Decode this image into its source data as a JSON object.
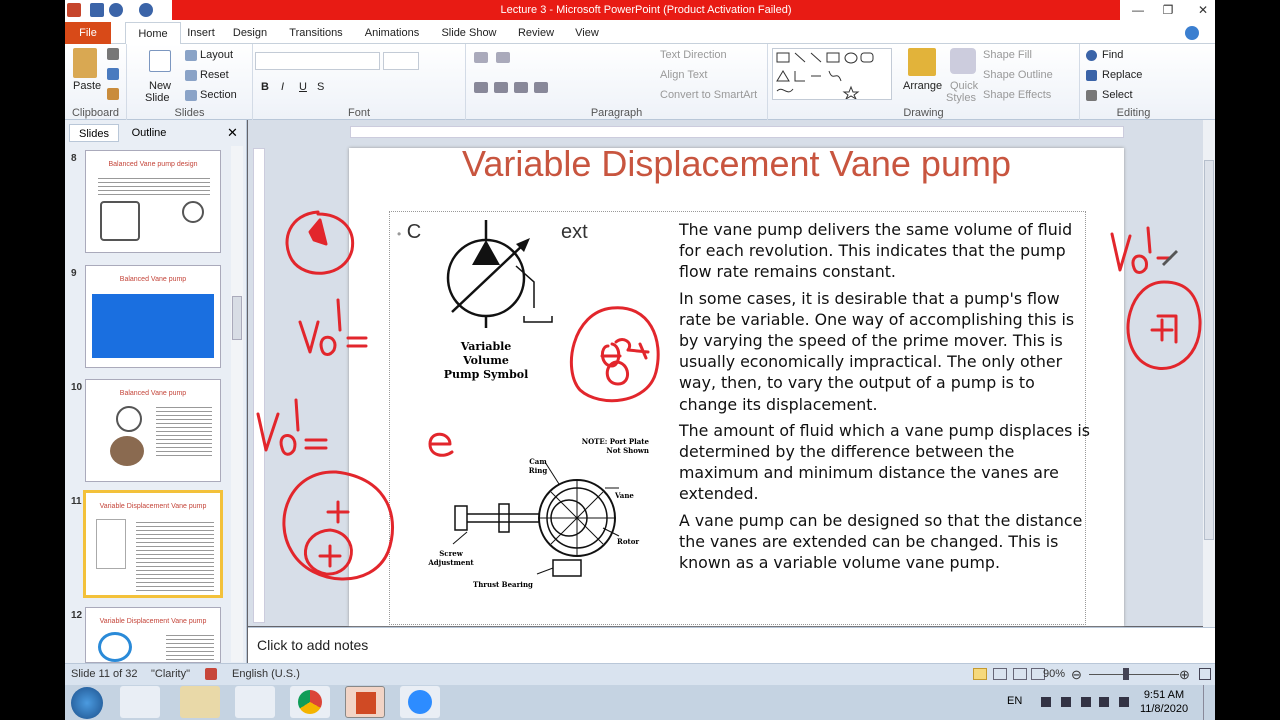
{
  "window": {
    "title": "Lecture 3  -  Microsoft PowerPoint (Product Activation Failed)"
  },
  "tabs": {
    "file": "File",
    "home": "Home",
    "insert": "Insert",
    "design": "Design",
    "transitions": "Transitions",
    "animations": "Animations",
    "slideshow": "Slide Show",
    "review": "Review",
    "view": "View"
  },
  "ribbon": {
    "clipboard": {
      "label": "Clipboard",
      "paste": "Paste"
    },
    "slides": {
      "label": "Slides",
      "new_slide_1": "New",
      "new_slide_2": "Slide",
      "layout": "Layout",
      "reset": "Reset",
      "section": "Section"
    },
    "font": {
      "label": "Font"
    },
    "paragraph": {
      "label": "Paragraph",
      "text_direction": "Text Direction",
      "align_text": "Align Text",
      "convert_smartart": "Convert to SmartArt"
    },
    "drawing": {
      "label": "Drawing",
      "arrange": "Arrange",
      "quick_styles_1": "Quick",
      "quick_styles_2": "Styles",
      "shape_fill": "Shape Fill",
      "shape_outline": "Shape Outline",
      "shape_effects": "Shape Effects"
    },
    "editing": {
      "label": "Editing",
      "find": "Find",
      "replace": "Replace",
      "select": "Select"
    }
  },
  "left_pane": {
    "tab_slides": "Slides",
    "tab_outline": "Outline",
    "thumbnails": [
      {
        "num": "8",
        "title": "Balanced Vane pump design"
      },
      {
        "num": "9",
        "title": "Balanced Vane pump"
      },
      {
        "num": "10",
        "title": "Balanced Vane pump"
      },
      {
        "num": "11",
        "title": "Variable Displacement Vane pump"
      },
      {
        "num": "12",
        "title": "Variable Displacement Vane pump"
      }
    ]
  },
  "slide": {
    "title": "Variable Displacement Vane pump",
    "bullet_fragment_a": "C",
    "bullet_fragment_b": "ext",
    "symbol_caption_1": "Variable Volume",
    "symbol_caption_2": "Pump Symbol",
    "diagram_labels": {
      "note": "NOTE: Port Plate",
      "not_shown": "Not Shown",
      "cam": "Cam",
      "ring": "Ring",
      "vane": "Vane",
      "rotor": "Rotor",
      "screw": "Screw",
      "adjustment": "Adjustment",
      "thrust": "Thrust Bearing"
    },
    "paragraphs": [
      "The vane pump delivers the same volume of fluid for each revolution. This indicates that the pump flow rate remains constant.",
      "In some cases, it is desirable that a pump's flow rate be variable. One way of accomplishing this is by varying the speed of the prime mover. This is usually economically impractical. The only other way, then, to vary the output of a pump is to change its displacement.",
      "The amount of fluid which a vane pump displaces is determined by the difference between the maximum and minimum distance the vanes are extended.",
      "A vane pump can be designed so that the distance the vanes are extended can be changed. This is known as a variable volume vane pump."
    ]
  },
  "notes": {
    "placeholder": "Click to add notes"
  },
  "status": {
    "slide_info": "Slide 11 of 32",
    "theme": "\"Clarity\"",
    "language": "English (U.S.)",
    "zoom": "90%"
  },
  "taskbar": {
    "lang": "EN",
    "time": "9:51 AM",
    "date": "11/8/2020"
  },
  "colors": {
    "title_red": "#e81b14",
    "file_tab": "#d84a18",
    "slide_title": "#c8553f",
    "ink": "#e2262c",
    "selected_thumb": "#f3c13a"
  }
}
